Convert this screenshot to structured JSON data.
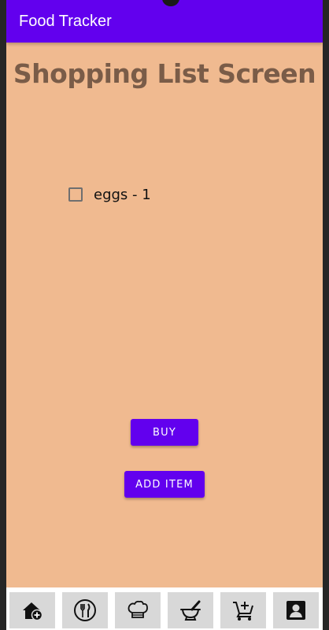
{
  "appbar": {
    "title": "Food Tracker"
  },
  "page": {
    "title": "Shopping List Screen"
  },
  "shopping_list": {
    "items": [
      {
        "label": "eggs - 1",
        "checked": false
      }
    ]
  },
  "actions": {
    "buy_label": "BUY",
    "add_item_label": "ADD ITEM"
  },
  "bottom_nav": {
    "items": [
      {
        "icon": "home-add-icon"
      },
      {
        "icon": "utensils-icon"
      },
      {
        "icon": "chef-hat-icon"
      },
      {
        "icon": "mortar-pestle-icon"
      },
      {
        "icon": "cart-add-icon"
      },
      {
        "icon": "account-box-icon"
      }
    ]
  },
  "colors": {
    "primary": "#6200EE",
    "background": "#F0BA90",
    "title_text": "#7A5C48",
    "nav_button": "#D8D8D8"
  }
}
